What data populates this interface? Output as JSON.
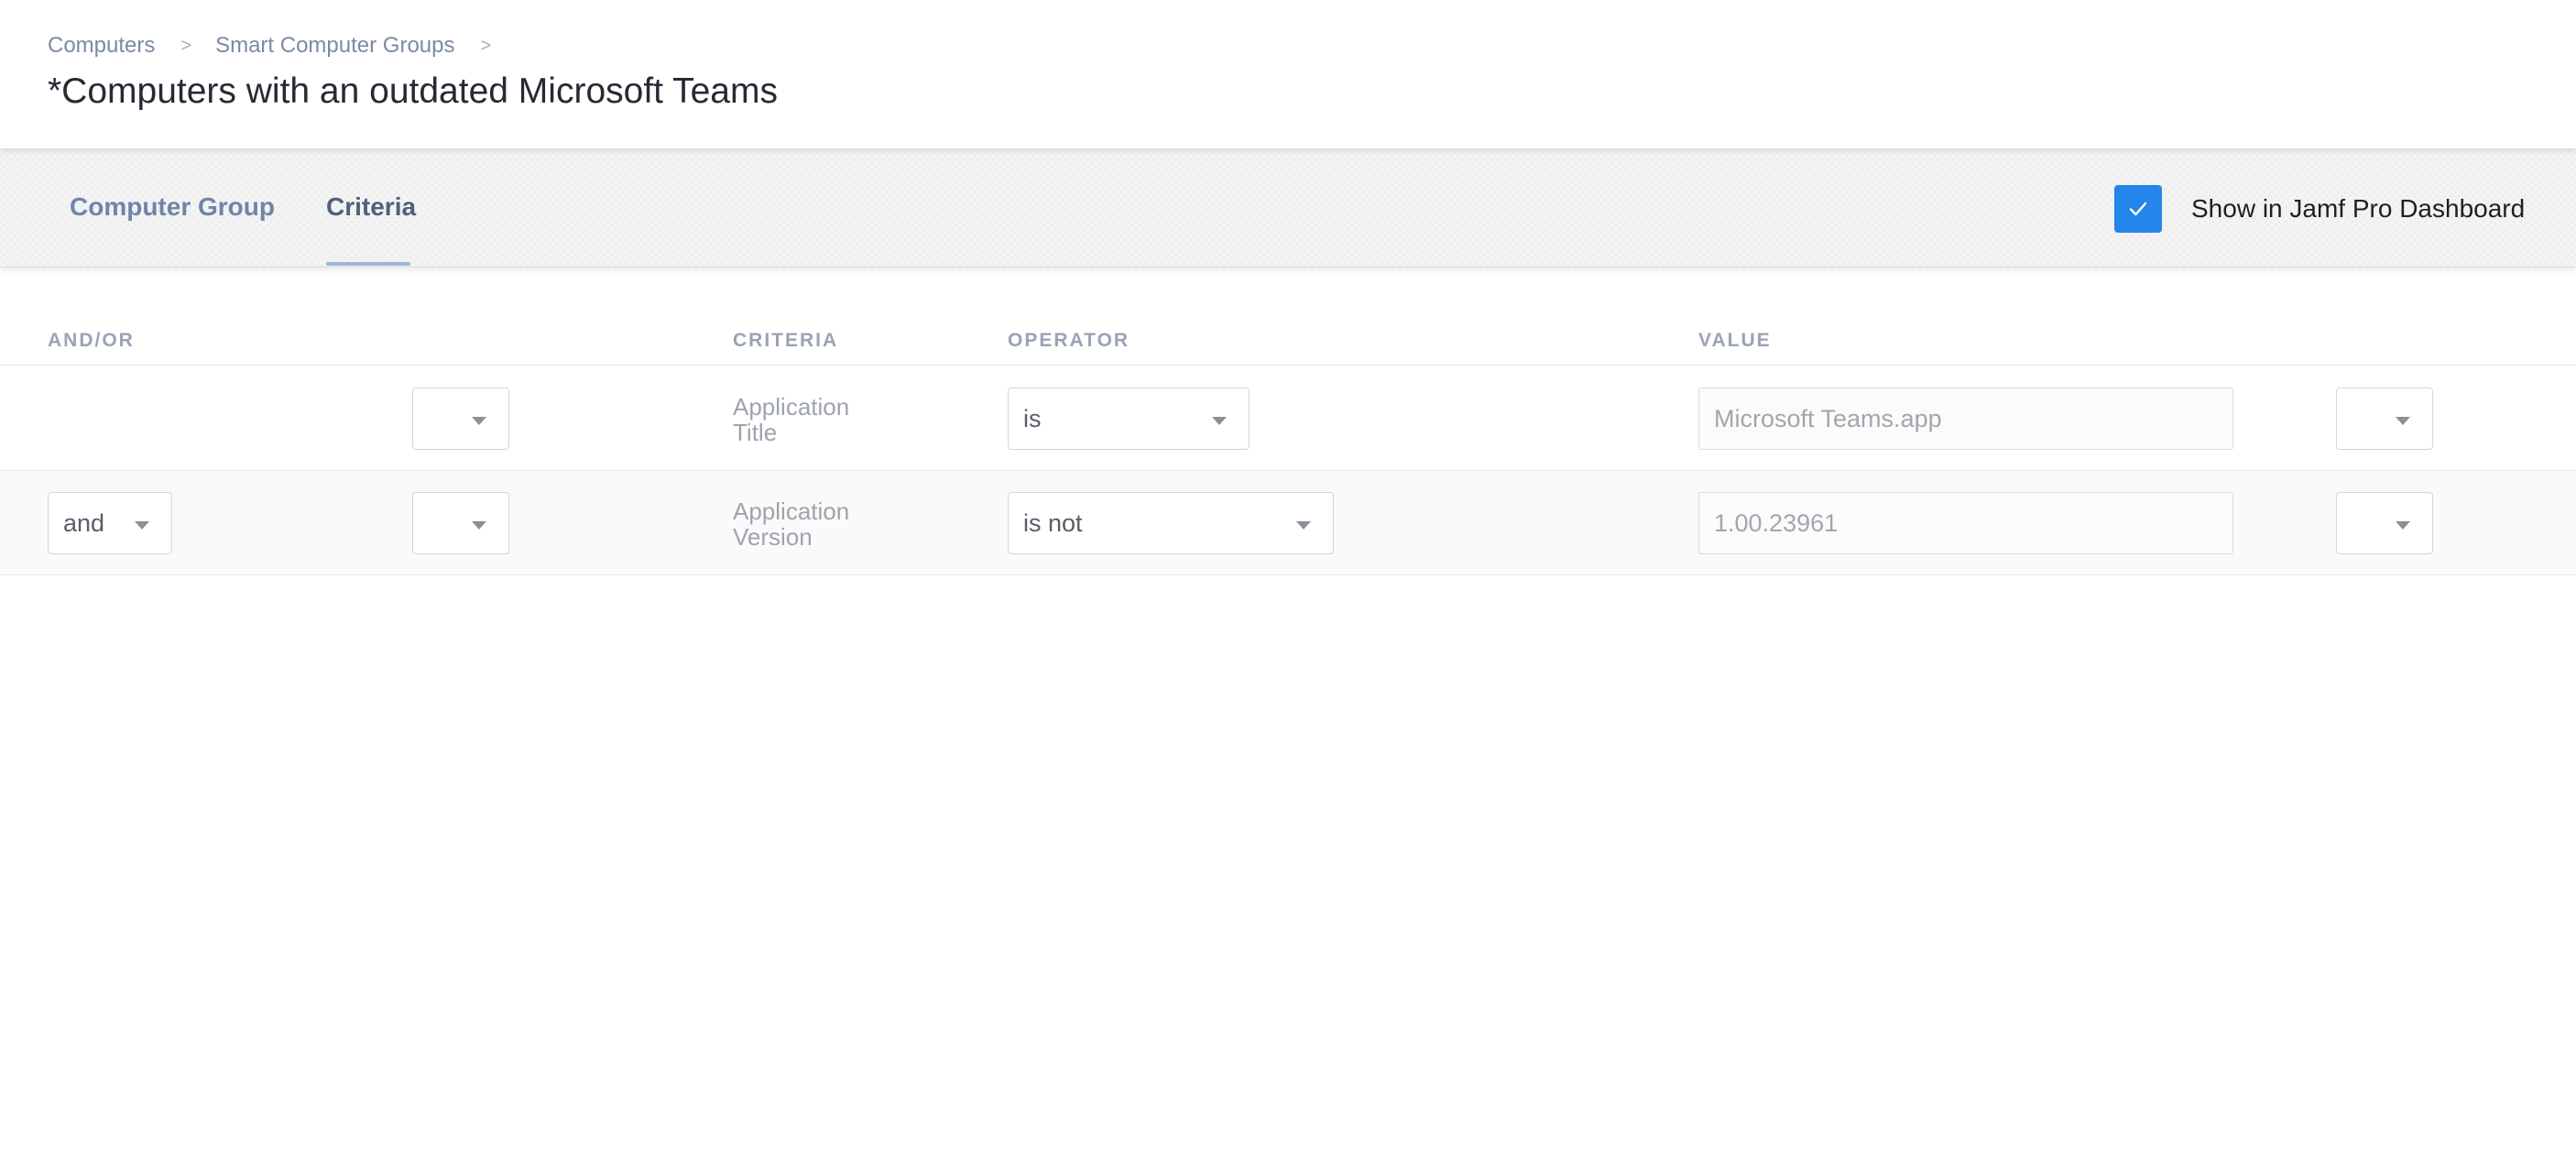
{
  "breadcrumb": {
    "items": [
      "Computers",
      "Smart Computer Groups"
    ],
    "separator": ">"
  },
  "page": {
    "title": "*Computers with an outdated Microsoft Teams"
  },
  "tabs": [
    {
      "label": "Computer Group",
      "active": false
    },
    {
      "label": "Criteria",
      "active": true
    }
  ],
  "dashboard_toggle": {
    "label": "Show in Jamf Pro Dashboard",
    "checked": true,
    "accent_color": "#2485ea"
  },
  "columns": {
    "and_or": "AND/OR",
    "criteria": "CRITERIA",
    "operator": "OPERATOR",
    "value": "VALUE"
  },
  "rows": [
    {
      "and_or": "",
      "open_paren": "",
      "criteria_line1": "Application",
      "criteria_line2": "Title",
      "operator": "is",
      "value": "Microsoft Teams.app",
      "close_paren": ""
    },
    {
      "and_or": "and",
      "open_paren": "",
      "criteria_line1": "Application",
      "criteria_line2": "Version",
      "operator": "is not",
      "value": "1.00.23961",
      "close_paren": ""
    }
  ]
}
